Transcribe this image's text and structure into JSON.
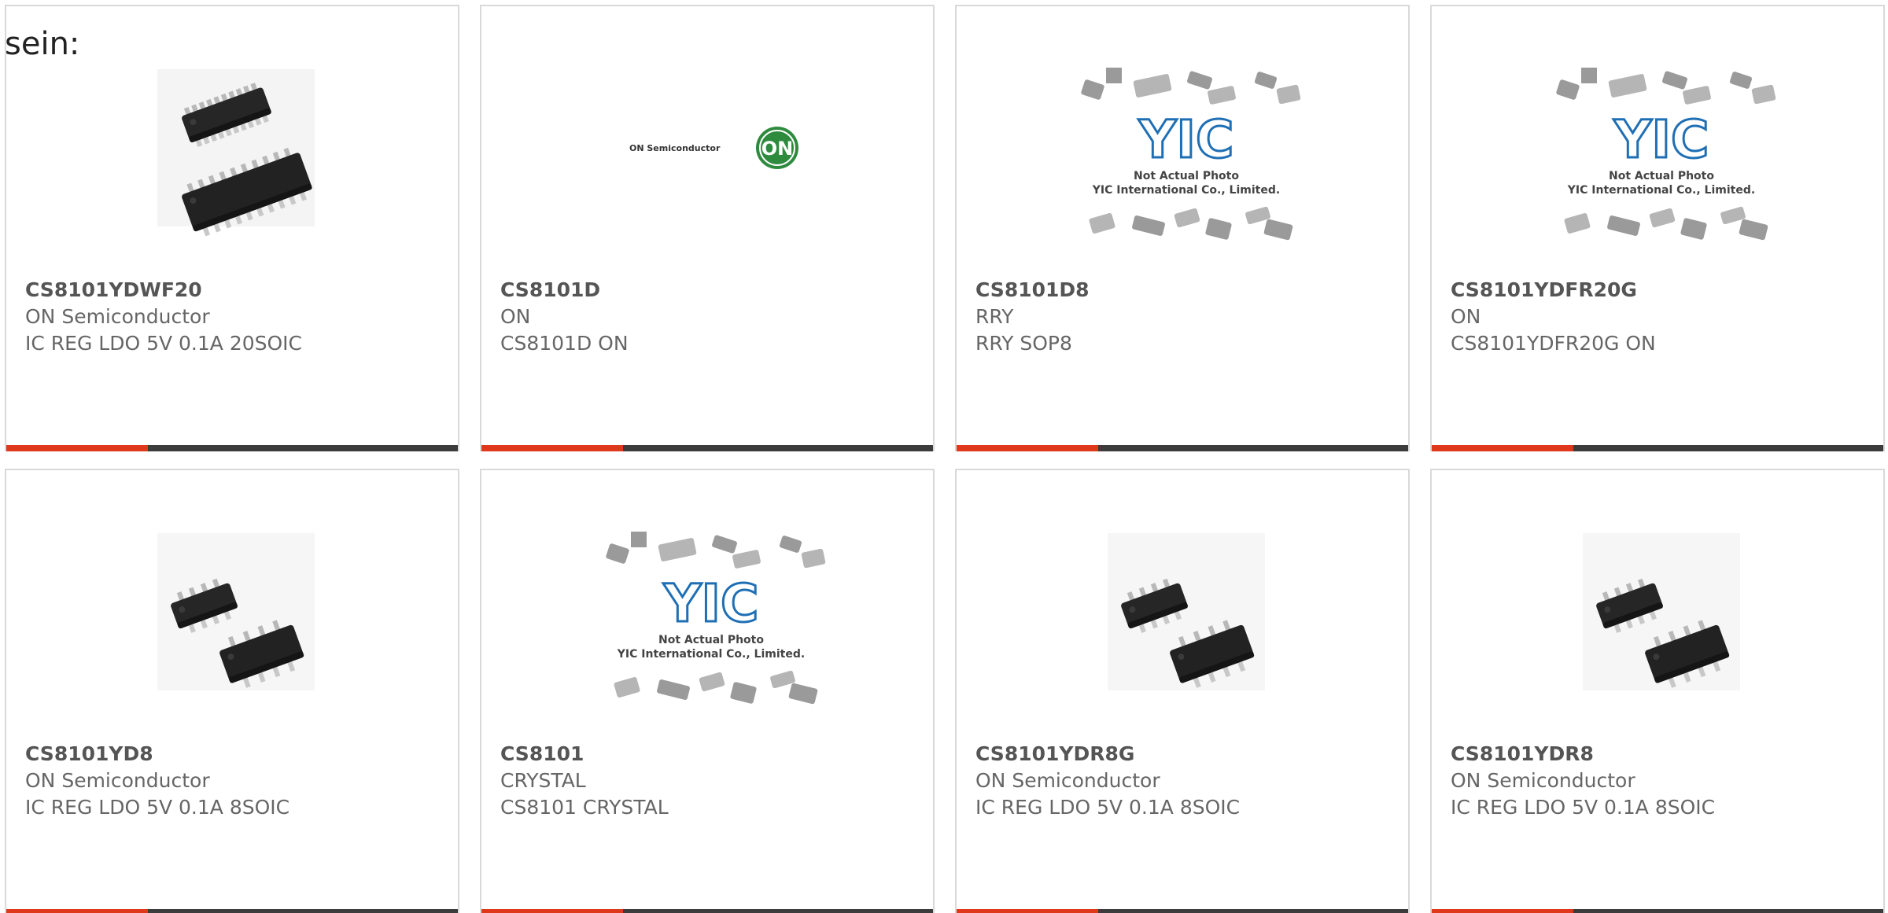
{
  "intro": {
    "text": "sein:"
  },
  "products": [
    {
      "part_number": "CS8101YDWF20",
      "manufacturer": "ON Semiconductor",
      "description": "IC REG LDO 5V 0.1A 20SOIC",
      "image": "soic-20-package-image"
    },
    {
      "part_number": "CS8101D",
      "manufacturer": "ON",
      "description": "CS8101D ON",
      "image": "on-semiconductor-logo-image"
    },
    {
      "part_number": "CS8101D8",
      "manufacturer": "RRY",
      "description": "RRY SOP8",
      "image": "yic-not-actual-photo-image"
    },
    {
      "part_number": "CS8101YDFR20G",
      "manufacturer": "ON",
      "description": "CS8101YDFR20G ON",
      "image": "yic-not-actual-photo-image"
    },
    {
      "part_number": "CS8101YD8",
      "manufacturer": "ON Semiconductor",
      "description": "IC REG LDO 5V 0.1A 8SOIC",
      "image": "soic-8-package-image"
    },
    {
      "part_number": "CS8101",
      "manufacturer": "CRYSTAL",
      "description": "CS8101 CRYSTAL",
      "image": "yic-not-actual-photo-image"
    },
    {
      "part_number": "CS8101YDR8G",
      "manufacturer": "ON Semiconductor",
      "description": "IC REG LDO 5V 0.1A 8SOIC",
      "image": "soic-8-package-image"
    },
    {
      "part_number": "CS8101YDR8",
      "manufacturer": "ON Semiconductor",
      "description": "IC REG LDO 5V 0.1A 8SOIC",
      "image": "soic-8-package-image"
    }
  ],
  "logo_text": {
    "on_semi": "ON Semiconductor",
    "on_badge": "ON",
    "yic_line1": "Not Actual Photo",
    "yic_line2": "YIC International Co., Limited.",
    "yic_mark": "YIC"
  },
  "colors": {
    "accent": "#e0381a",
    "bar": "#3c3c3c",
    "border": "#d9d9d9",
    "text": "#666666",
    "on_green": "#2e8b3e",
    "yic_blue": "#1f6fb5"
  }
}
